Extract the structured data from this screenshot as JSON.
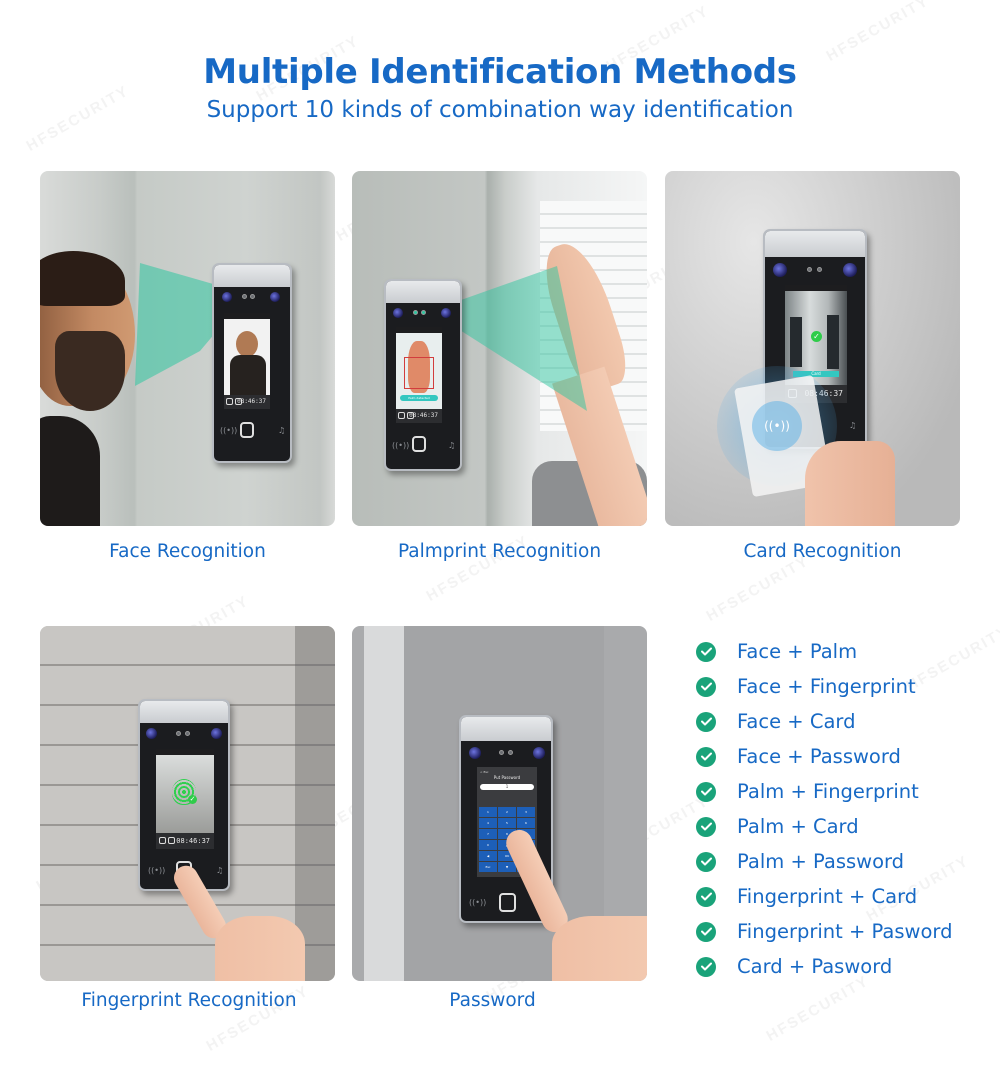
{
  "header": {
    "title": "Multiple Identification Methods",
    "subtitle": "Support 10 kinds of combination way identification"
  },
  "watermark_text": "HFSECURITY",
  "methods": [
    {
      "caption": "Face Recognition",
      "screen": {
        "clock": "08:46:37",
        "scene": "face-profile"
      }
    },
    {
      "caption": "Palmprint Recognition",
      "screen": {
        "clock": "08:46:37",
        "scene": "palm-scan",
        "banner": "Palm detected"
      }
    },
    {
      "caption": "Card Recognition",
      "screen": {
        "clock": "08:46:37",
        "scene": "corridor",
        "banner": "Card"
      }
    },
    {
      "caption": "Fingerprint Recognition",
      "screen": {
        "clock": "08:46:37",
        "scene": "office-fingerprint"
      }
    },
    {
      "caption": "Password",
      "screen": {
        "back_label": "< Esc",
        "prompt": "Put Password",
        "entered": "1",
        "keys": [
          "1",
          "2",
          "3",
          "4",
          "5",
          "6",
          "7",
          "8",
          "9",
          "0",
          "▲",
          "Del",
          "◀",
          "OK",
          "▶",
          "Esc",
          "▼",
          "Enter"
        ]
      }
    }
  ],
  "combinations": [
    "Face + Palm",
    "Face + Fingerprint",
    "Face + Card",
    "Face + Password",
    "Palm + Fingerprint",
    "Palm + Card",
    "Palm + Password",
    "Fingerprint + Card",
    "Fingerprint + Pasword",
    "Card + Pasword"
  ],
  "colors": {
    "heading": "#1769c5",
    "check": "#1aa37a",
    "beam": "#2fc6a0"
  }
}
